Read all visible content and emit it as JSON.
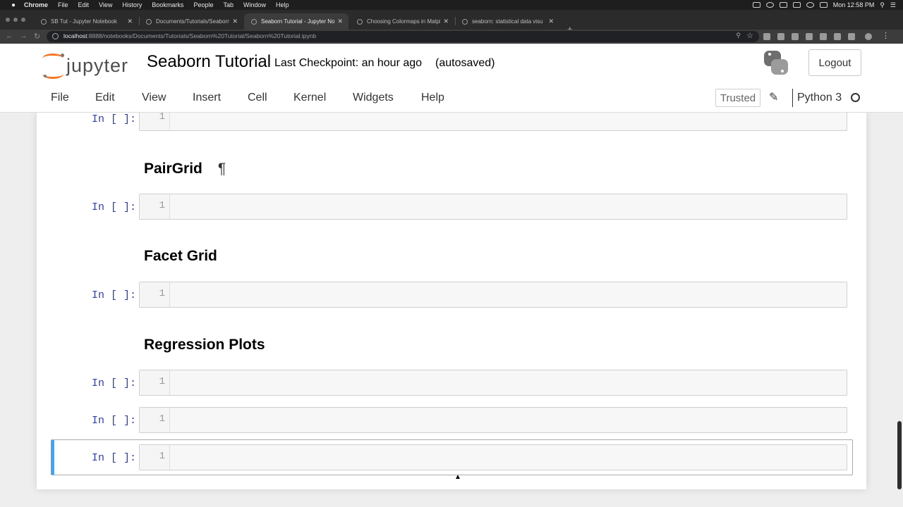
{
  "mac_menubar": {
    "app": "Chrome",
    "items": [
      "File",
      "Edit",
      "View",
      "History",
      "Bookmarks",
      "People",
      "Tab",
      "Window",
      "Help"
    ],
    "clock": "Mon 12:58 PM"
  },
  "browser": {
    "tabs": [
      {
        "title": "SB Tut - Jupyter Notebook",
        "active": false
      },
      {
        "title": "Documents/Tutorials/Seaborn",
        "active": false
      },
      {
        "title": "Seaborn Tutorial - Jupyter Note",
        "active": true
      },
      {
        "title": "Choosing Colormaps in Matplo",
        "active": false
      },
      {
        "title": "seaborn: statistical data visu",
        "active": false
      }
    ],
    "url_host": "localhost",
    "url_path": ":8888/notebooks/Documents/Tutorials/Seaborn%20Tutorial/Seaborn%20Tutorial.ipynb"
  },
  "jupyter": {
    "logo_text": "jupyter",
    "notebook_title": "Seaborn Tutorial",
    "checkpoint": "Last Checkpoint: an hour ago",
    "autosave": "(autosaved)",
    "logout_label": "Logout",
    "menu": [
      "File",
      "Edit",
      "View",
      "Insert",
      "Cell",
      "Kernel",
      "Widgets",
      "Help"
    ],
    "trusted_label": "Trusted",
    "kernel_name": "Python 3"
  },
  "cells": [
    {
      "type": "code",
      "prompt": "In [ ]:",
      "line": "1"
    },
    {
      "type": "markdown",
      "heading": "PairGrid",
      "anchor": "¶"
    },
    {
      "type": "code",
      "prompt": "In [ ]:",
      "line": "1"
    },
    {
      "type": "markdown",
      "heading": "Facet Grid"
    },
    {
      "type": "code",
      "prompt": "In [ ]:",
      "line": "1"
    },
    {
      "type": "markdown",
      "heading": "Regression Plots"
    },
    {
      "type": "code",
      "prompt": "In [ ]:",
      "line": "1"
    },
    {
      "type": "code",
      "prompt": "In [ ]:",
      "line": "1"
    },
    {
      "type": "code",
      "prompt": "In [ ]:",
      "line": "1",
      "selected": true
    }
  ],
  "colors": {
    "jupyter_orange": "#f37726",
    "prompt_blue": "#303f9f",
    "selected_cell_border": "#42a5f5"
  }
}
